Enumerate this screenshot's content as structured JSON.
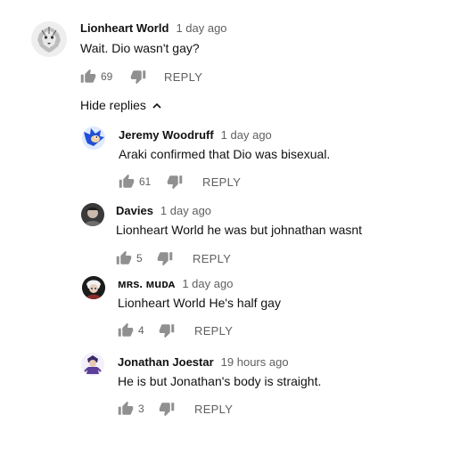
{
  "thread": {
    "top": {
      "author": "Lionheart World",
      "time": "1 day ago",
      "text": "Wait. Dio wasn't gay?",
      "likes": "69",
      "reply_label": "REPLY",
      "avatar_icon": "lion-avatar-icon"
    },
    "hide_replies_label": "Hide replies",
    "replies": [
      {
        "author": "Jeremy Woodruff",
        "time": "1 day ago",
        "text": "Araki confirmed that Dio was bisexual.",
        "likes": "61",
        "reply_label": "REPLY",
        "avatar_icon": "sonic-avatar-icon"
      },
      {
        "author": "Davies",
        "time": "1 day ago",
        "text": "Lionheart World he was but johnathan wasnt",
        "likes": "5",
        "reply_label": "REPLY",
        "avatar_icon": "portrait-avatar-icon"
      },
      {
        "author": "ᴍʀs. ᴍuᴅᴀ",
        "time": "1 day ago",
        "text": "Lionheart World He's half gay",
        "likes": "4",
        "reply_label": "REPLY",
        "avatar_icon": "anime-avatar-icon"
      },
      {
        "author": "Jonathan Joestar",
        "time": "19 hours ago",
        "text": "He is but Jonathan's body is straight.",
        "likes": "3",
        "reply_label": "REPLY",
        "avatar_icon": "character-avatar-icon"
      }
    ]
  },
  "colors": {
    "text_primary": "#111111",
    "text_secondary": "#606060",
    "icon_gray": "#909090",
    "background": "#ffffff"
  }
}
